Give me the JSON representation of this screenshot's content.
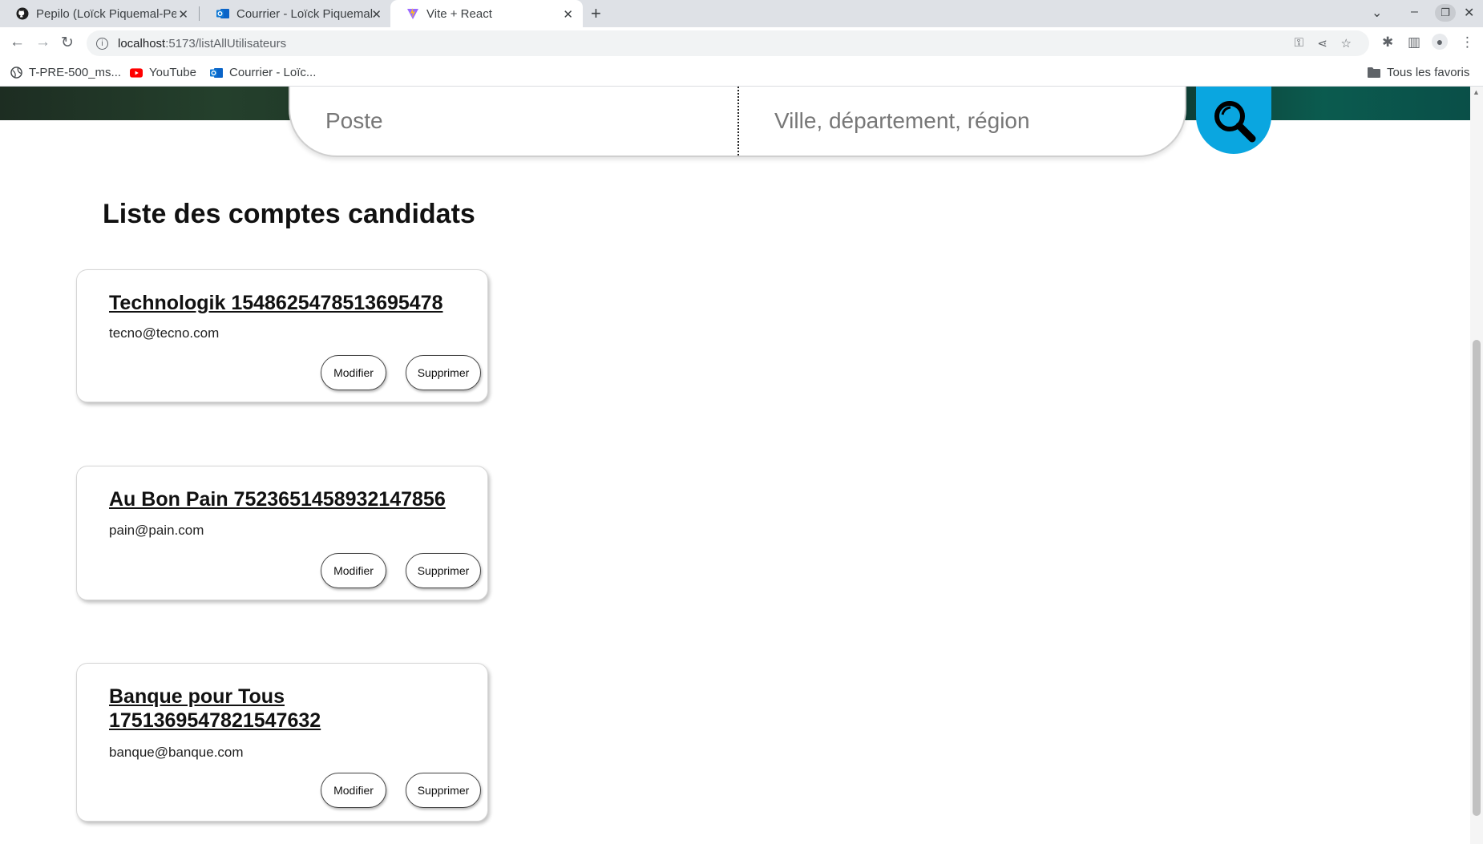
{
  "browser": {
    "tabs": [
      {
        "title": "Pepilo (Loïck Piquemal-Pe",
        "icon": "github-icon"
      },
      {
        "title": "Courrier - Loïck Piquemal",
        "icon": "outlook-icon"
      },
      {
        "title": "Vite + React",
        "icon": "vite-icon",
        "active": true
      }
    ],
    "url_host": "localhost",
    "url_path": ":5173/listAllUtilisateurs",
    "bookmarks": [
      {
        "label": "T-PRE-500_ms...",
        "icon": "globe-icon"
      },
      {
        "label": "YouTube",
        "icon": "youtube-icon"
      },
      {
        "label": "Courrier - Loïc...",
        "icon": "outlook-icon"
      }
    ],
    "all_bookmarks_label": "Tous les favoris"
  },
  "search": {
    "job_placeholder": "Poste",
    "location_placeholder": "Ville, département, région",
    "button_icon": "magnifier-icon"
  },
  "page": {
    "title": "Liste des comptes candidats"
  },
  "cards": [
    {
      "name": "Technologik 1548625478513695478",
      "email": "tecno@tecno.com",
      "edit_label": "Modifier",
      "delete_label": "Supprimer"
    },
    {
      "name": "Au Bon Pain 7523651458932147856",
      "email": "pain@pain.com",
      "edit_label": "Modifier",
      "delete_label": "Supprimer"
    },
    {
      "name": "Banque pour Tous 1751369547821547632",
      "email": "banque@banque.com",
      "edit_label": "Modifier",
      "delete_label": "Supprimer"
    }
  ],
  "colors": {
    "search_button": "#0aa6e0",
    "tabbar": "#dee1e6"
  }
}
